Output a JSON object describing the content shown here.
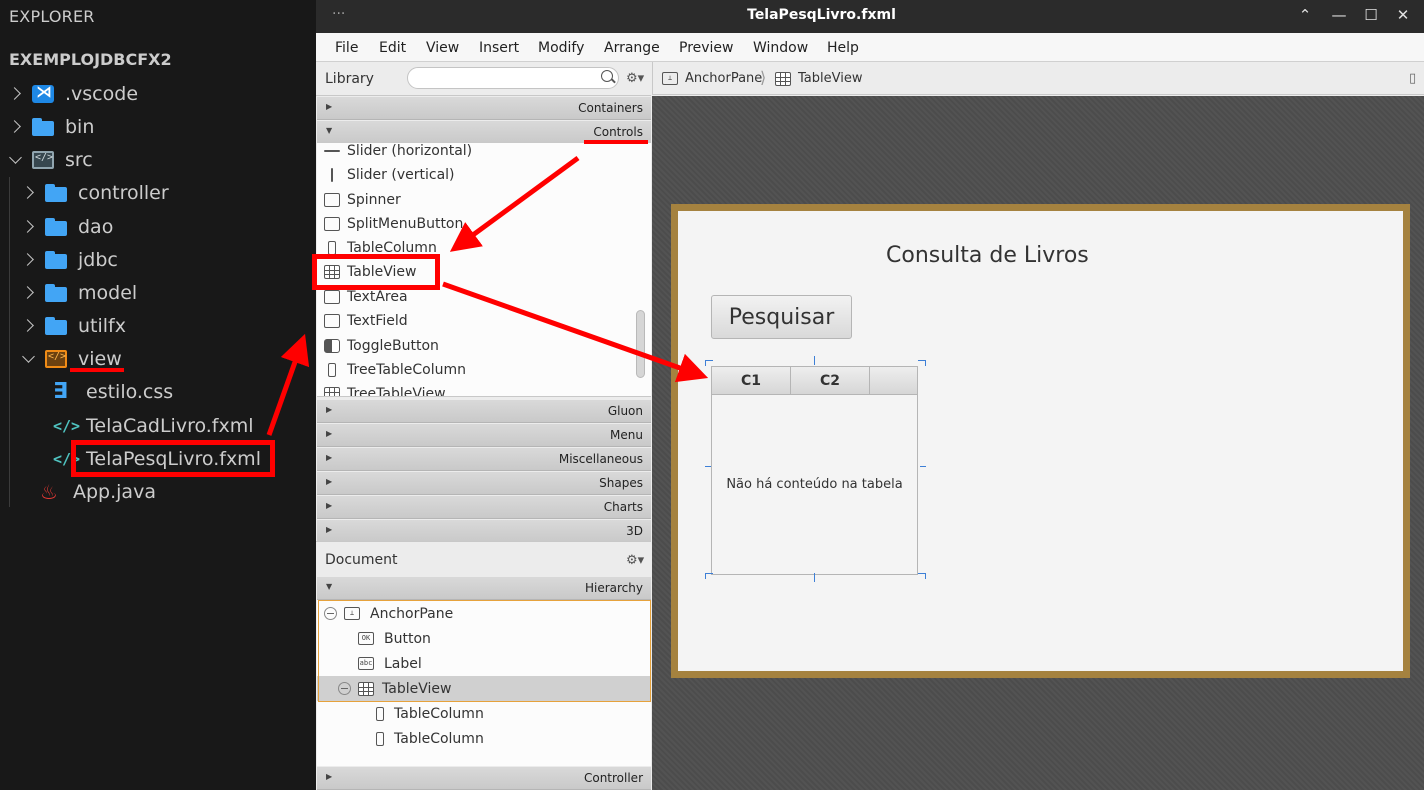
{
  "explorer": {
    "title": "EXPLORER",
    "project": "EXEMPLOJDBCFX2",
    "items": [
      {
        "label": ".vscode"
      },
      {
        "label": "bin"
      },
      {
        "label": "src"
      },
      {
        "label": "controller"
      },
      {
        "label": "dao"
      },
      {
        "label": "jdbc"
      },
      {
        "label": "model"
      },
      {
        "label": "utilfx"
      },
      {
        "label": "view"
      },
      {
        "label": "estilo.css"
      },
      {
        "label": "TelaCadLivro.fxml"
      },
      {
        "label": "TelaPesqLivro.fxml"
      },
      {
        "label": "App.java"
      }
    ]
  },
  "window": {
    "dots": "···",
    "title": "TelaPesqLivro.fxml",
    "minimize": "⌃",
    "min_glyph": "—",
    "max_glyph": "☐",
    "close_glyph": "✕"
  },
  "menu": [
    "File",
    "Edit",
    "View",
    "Insert",
    "Modify",
    "Arrange",
    "Preview",
    "Window",
    "Help"
  ],
  "library": {
    "label": "Library",
    "search_value": "",
    "sections_top": [
      "Containers",
      "Controls"
    ],
    "controls": [
      "Slider  (horizontal)",
      "Slider  (vertical)",
      "Spinner",
      "SplitMenuButton",
      "TableColumn",
      "TableView",
      "TextArea",
      "TextField",
      "ToggleButton",
      "TreeTableColumn",
      "TreeTableView"
    ],
    "sections_bottom": [
      "Gluon",
      "Menu",
      "Miscellaneous",
      "Shapes",
      "Charts",
      "3D"
    ]
  },
  "document": {
    "label": "Document",
    "hierarchy_label": "Hierarchy",
    "controller_label": "Controller",
    "nodes": [
      "AnchorPane",
      "Button",
      "Label",
      "TableView",
      "TableColumn",
      "TableColumn"
    ]
  },
  "breadcrumb": [
    "AnchorPane",
    "TableView"
  ],
  "stage": {
    "title": "Consulta de Livros",
    "button": "Pesquisar",
    "columns": [
      "C1",
      "C2"
    ],
    "empty": "Não há conteúdo na tabela"
  },
  "colors": {
    "annotation": "#ff0000",
    "stage_border": "#a5823f",
    "selection_outline": "#e6a23c"
  }
}
